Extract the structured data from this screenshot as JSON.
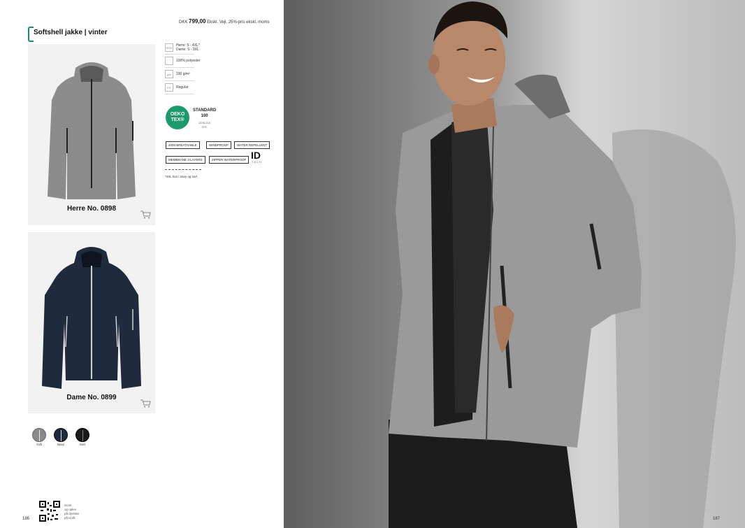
{
  "price": {
    "amount": "799,00",
    "prefix": "DKK",
    "note": "Ekskl. Vejl. 25%-pris ekskl. moms"
  },
  "title": "Softshell jakke | vinter",
  "products": [
    {
      "name": "Herre No. 0898",
      "color": "#8c8c8c"
    },
    {
      "name": "Dame No. 0899",
      "color": "#1f2a3c"
    }
  ],
  "specs": [
    {
      "icon": "size-icon",
      "icon_text": "SIZE",
      "lines": [
        "Herre: S - 4XL*",
        "Dame: S - 3XL"
      ]
    },
    {
      "icon": "fabric-icon",
      "icon_text": "",
      "lines": [
        "100% polyester"
      ]
    },
    {
      "icon": "weight-icon",
      "icon_text": "g/m",
      "lines": [
        "190 g/m²"
      ]
    },
    {
      "icon": "fit-icon",
      "icon_text": "FIT",
      "lines": [
        "Regular"
      ]
    }
  ],
  "certification": {
    "logo_line1": "OEKO",
    "logo_line2": "TEX®",
    "standard": "STANDARD",
    "standard_num": "100",
    "code": "1376-215",
    "institute": "DTI"
  },
  "features": [
    "4000 BREATHABLE",
    "WINDPROOF",
    "WATER REPELLENT",
    "MEMBRANE 3-LAYERS",
    "ZIPPER WATERPROOF"
  ],
  "brand": {
    "logo": "ID",
    "sub": "TECH"
  },
  "footnote": "*4XL kun i navy og sort",
  "colors": [
    {
      "label": "Grå",
      "hex": "#8a8a8a"
    },
    {
      "label": "Navy",
      "hex": "#1f2a3c"
    },
    {
      "label": "Sort",
      "hex": "#1a1a1a"
    }
  ],
  "qr_text": [
    "Scan",
    "og oplev",
    "på dyreste",
    "på id.dk"
  ],
  "page_left": "186",
  "page_right": "187"
}
